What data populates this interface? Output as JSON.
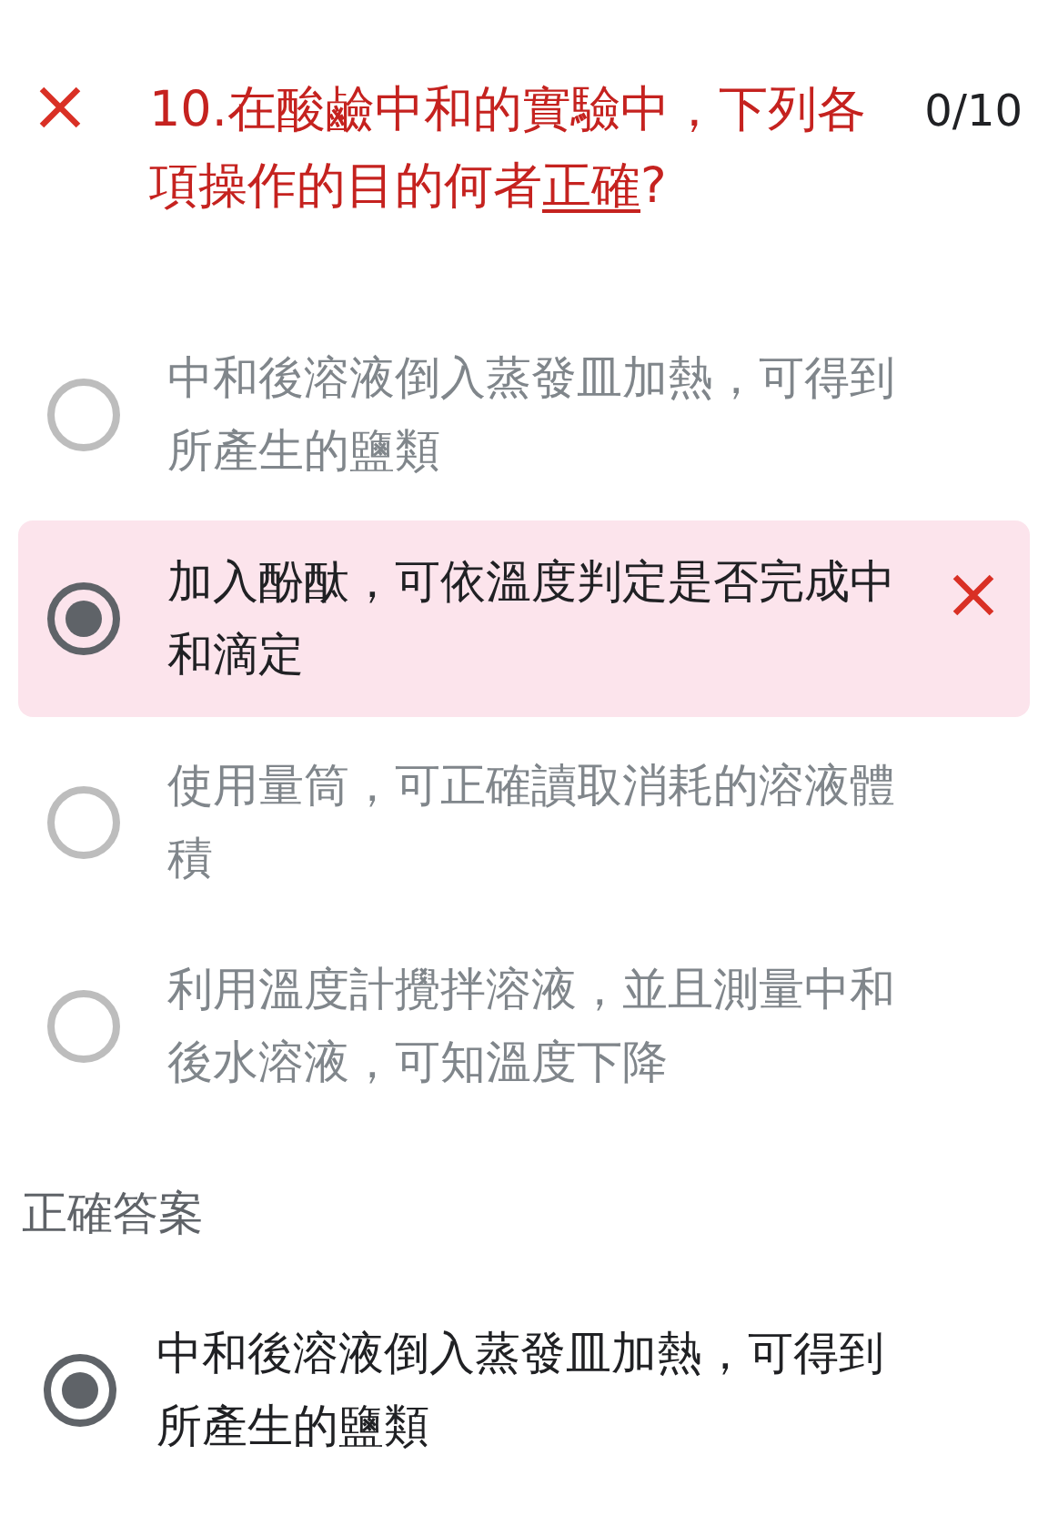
{
  "question": {
    "correct": false,
    "text": "10.在酸鹼中和的實驗中，下列各項操作的目的何者",
    "underlined": "正確",
    "suffix": "?",
    "score": "0/10"
  },
  "options": [
    {
      "label": "中和後溶液倒入蒸發皿加熱，可得到所產生的鹽類",
      "selected": false
    },
    {
      "label": "加入酚酞，可依溫度判定是否完成中和滴定",
      "selected": true
    },
    {
      "label": "使用量筒，可正確讀取消耗的溶液體積",
      "selected": false
    },
    {
      "label": "利用溫度計攪拌溶液，並且測量中和後水溶液，可知溫度下降",
      "selected": false
    }
  ],
  "correct_answer": {
    "heading": "正確答案",
    "label": "中和後溶液倒入蒸發皿加熱，可得到所產生的鹽類",
    "selected": true
  }
}
